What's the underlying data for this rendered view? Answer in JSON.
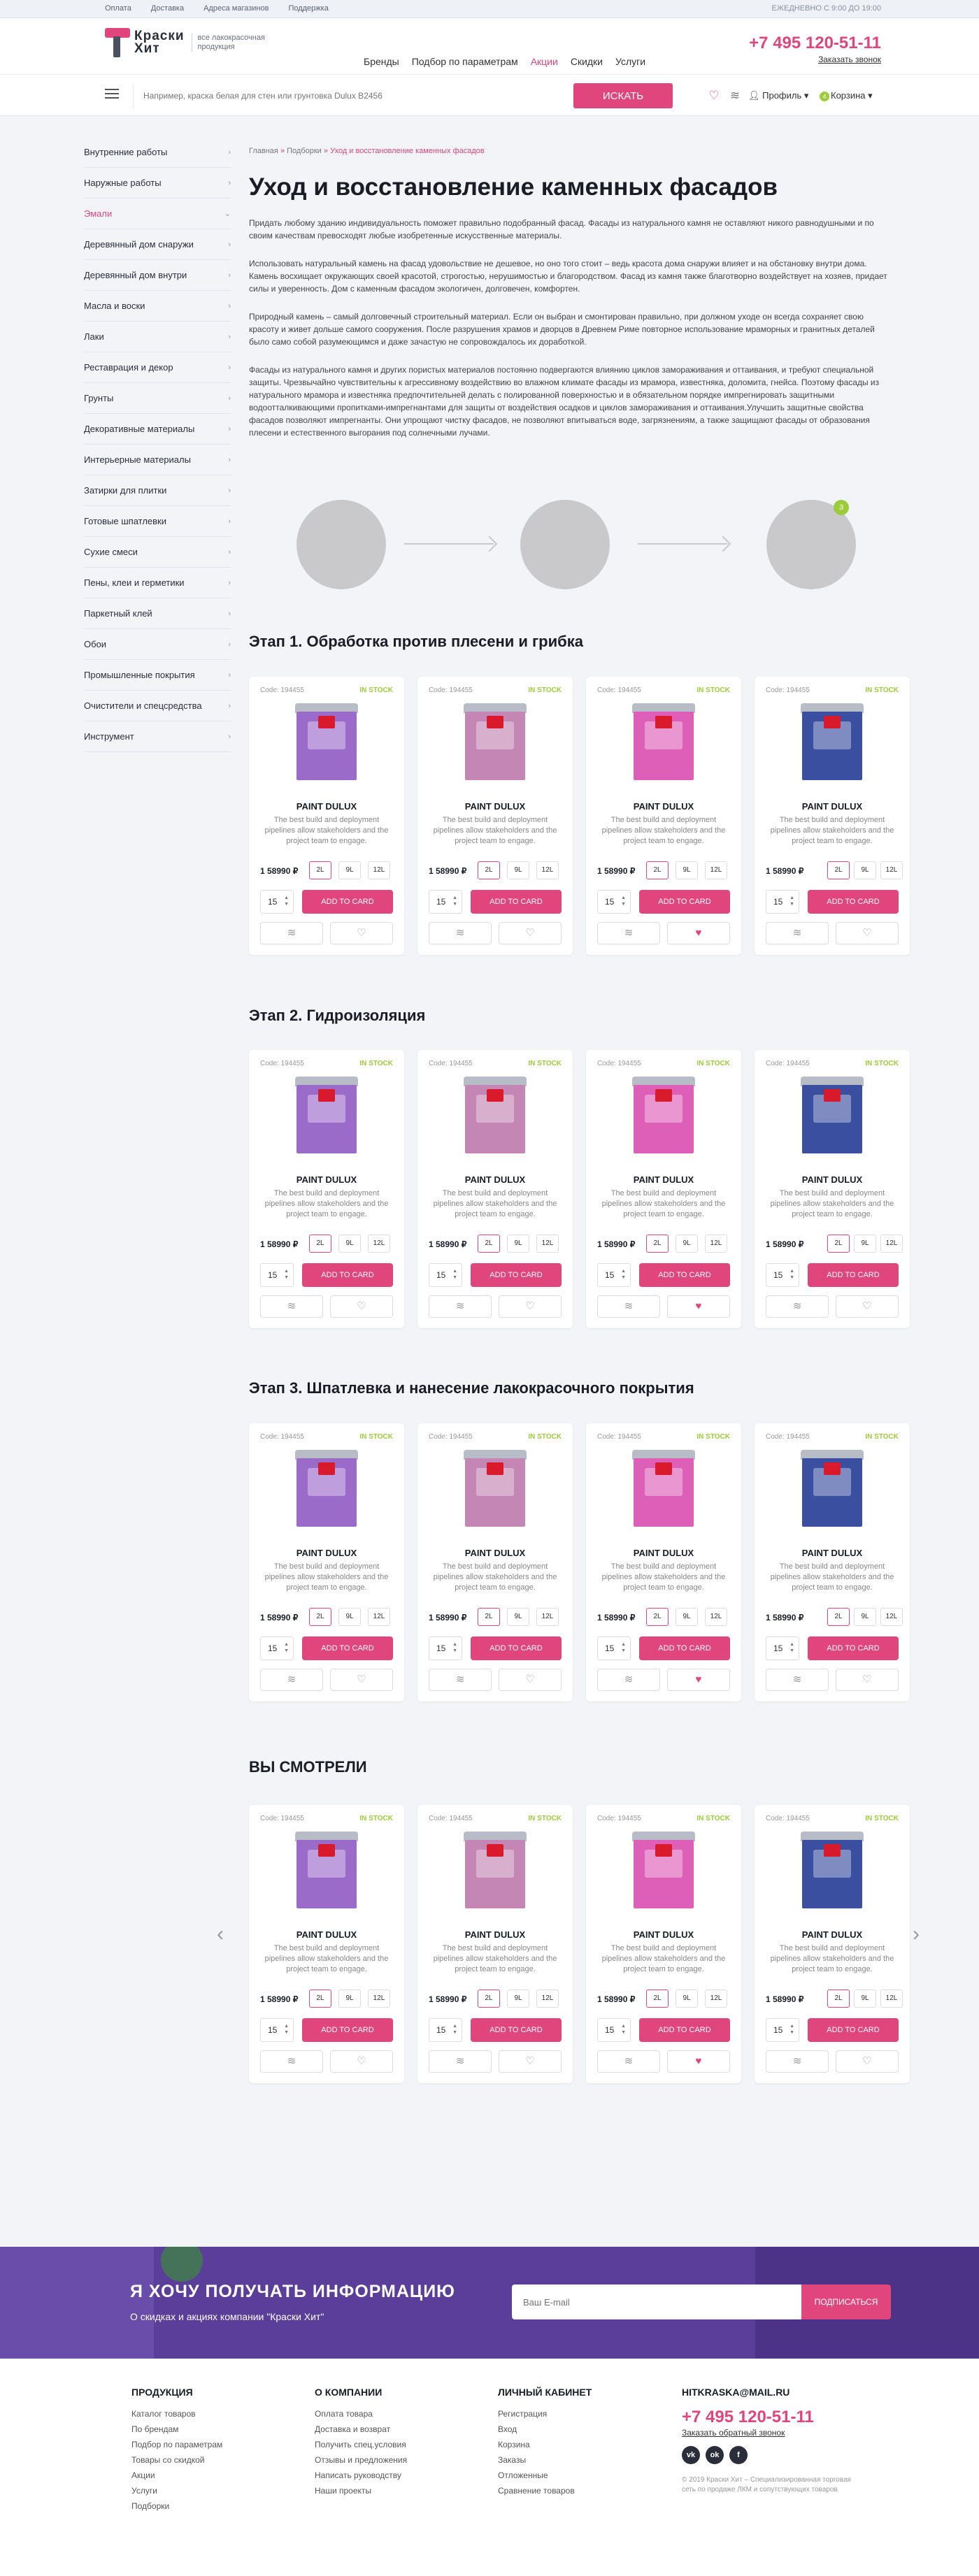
{
  "topbar": {
    "links": [
      "Оплата",
      "Доставка",
      "Адреса магазинов",
      "Поддержка"
    ],
    "hours": "ЕЖЕДНЕВНО С 9:00 ДО 19:00"
  },
  "header": {
    "logo_text_1": "Краски",
    "logo_text_2": "Хит",
    "logo_subtitle": "все лакокрасочная продукция",
    "nav": [
      "Бренды",
      "Подбор по параметрам",
      "Акции",
      "Скидки",
      "Услуги"
    ],
    "nav_active_index": 2,
    "phone": "+7 495 120-51-11",
    "callback": "Заказать звонок"
  },
  "search": {
    "placeholder": "Например, краска белая для стен или грунтовка Dulux B2456",
    "button": "ИСКАТЬ",
    "profile": "Профиль",
    "cart": "Корзина",
    "cart_count": "4"
  },
  "sidebar": {
    "items": [
      "Внутренние работы",
      "Наружные работы",
      "Эмали",
      "Деревянный дом снаружи",
      "Деревянный дом внутри",
      "Масла и воски",
      "Лаки",
      "Реставрация и декор",
      "Грунты",
      "Декоративные материалы",
      "Интерьерные материалы",
      "Затирки для плитки",
      "Готовые шпатлевки",
      "Сухие смеси",
      "Пены, клеи и герметики",
      "Паркетный клей",
      "Обои",
      "Промышленные покрытия",
      "Очистители и спецсредства",
      "Инструмент"
    ],
    "active_index": 2
  },
  "breadcrumbs": [
    "Главная",
    "Подборки",
    "Уход и восстановление каменных фасадов"
  ],
  "page": {
    "title": "Уход и восстановление каменных фасадов",
    "paragraphs": [
      "Придать любому зданию индивидуальность поможет правильно подобранный фасад. Фасады из натурального камня не оставляют никого равнодушными и по своим качествам превосходят любые изобретенные искусственные материалы.",
      "Использовать натуральный камень на фасад удовольствие не дешевое, но оно того стоит – ведь красота дома снаружи влияет и на обстановку внутри дома. Камень восхищает окружающих своей красотой, строгостью, нерушимостью и благородством. Фасад из камня также благотворно воздействует на хозяев, придает силы и уверенность. Дом с каменным фасадом экологичен, долговечен, комфортен.",
      "Природный камень – самый долговечный строительный материал. Если он выбран и смонтирован правильно, при должном уходе он всегда сохраняет свою красоту и живет дольше самого сооружения. После разрушения храмов и дворцов в Древнем Риме повторное использование мраморных и гранитных деталей было само собой разумеющимся и даже зачастую не сопровождалось их доработкой.",
      "Фасады из натурального камня и других пористых материалов постоянно подвергаются влиянию циклов замораживания и оттаивания, и требуют специальной защиты. Чрезвычайно чувствительны к агрессивному воздействию во влажном климате фасады из мрамора, известняка, доломита, гнейса. Поэтому фасады из натурального мрамора и известняка предпочтительней делать с полированной поверхностью и в обязательном порядке импрегнировать защитными водоотталкивающими пропитками-импрегнантами для защиты от воздействия осадков и циклов замораживания и оттаивания.Улучшить защитные свойства фасадов позволяют импрегнанты. Они упрощают чистку фасадов, не позволяют впитываться воде, загрязнениям, а также защищают фасады от образования плесени и естественного выгорания под солнечными лучами."
    ],
    "step_badge": "3"
  },
  "sections": [
    {
      "title": "Этап 1. Обработка против плесени и грибка"
    },
    {
      "title": "Этап 2. Гидроизоляция"
    },
    {
      "title": "Этап 3. Шпатлевка и нанесение лакокрасочного покрытия"
    },
    {
      "title": "ВЫ СМОТРЕЛИ"
    }
  ],
  "product": {
    "code": "Code: 194455",
    "stock": "IN STOCK",
    "name": "PAINT DULUX",
    "desc": "The best build and deployment pipelines allow stakeholders and the project team to engage.",
    "price": "1 58990 ₽",
    "volumes": [
      "2L",
      "9L",
      "12L"
    ],
    "qty": "15",
    "add": "ADD TO CARD"
  },
  "product_colors": [
    "#9b6bc9",
    "#c486b4",
    "#de5fb8",
    "#3a4fa0"
  ],
  "product_liked": [
    false,
    false,
    true,
    false
  ],
  "subscribe": {
    "title": "Я ХОЧУ ПОЛУЧАТЬ ИНФОРМАЦИЮ",
    "text": "О скидках и акциях компании \"Краски Хит\"",
    "placeholder": "Ваш E-mail",
    "button": "ПОДПИСАТЬСЯ"
  },
  "footer": {
    "cols": [
      {
        "title": "ПРОДУКЦИЯ",
        "links": [
          "Каталог товаров",
          "По брендам",
          "Подбор по параметрам",
          "Товары со скидкой",
          "Акции",
          "Услуги",
          "Подборки"
        ]
      },
      {
        "title": "О КОМПАНИИ",
        "links": [
          "Оплата товара",
          "Доставка и возврат",
          "Получить спец.условия",
          "Отзывы и предложения",
          "Написать руководству",
          "Наши проекты"
        ]
      },
      {
        "title": "ЛИЧНЫЙ КАБИНЕТ",
        "links": [
          "Регистрация",
          "Вход",
          "Корзина",
          "Заказы",
          "Отложенные",
          "Сравнение товаров"
        ]
      }
    ],
    "email": "HITKRASKA@MAIL.RU",
    "phone": "+7 495 120-51-11",
    "callback": "Заказать обратный звонок",
    "copyright": "© 2019 Краски Хит – Специализированная торговая сеть по продаже ЛКМ и сопутствующих товаров"
  }
}
